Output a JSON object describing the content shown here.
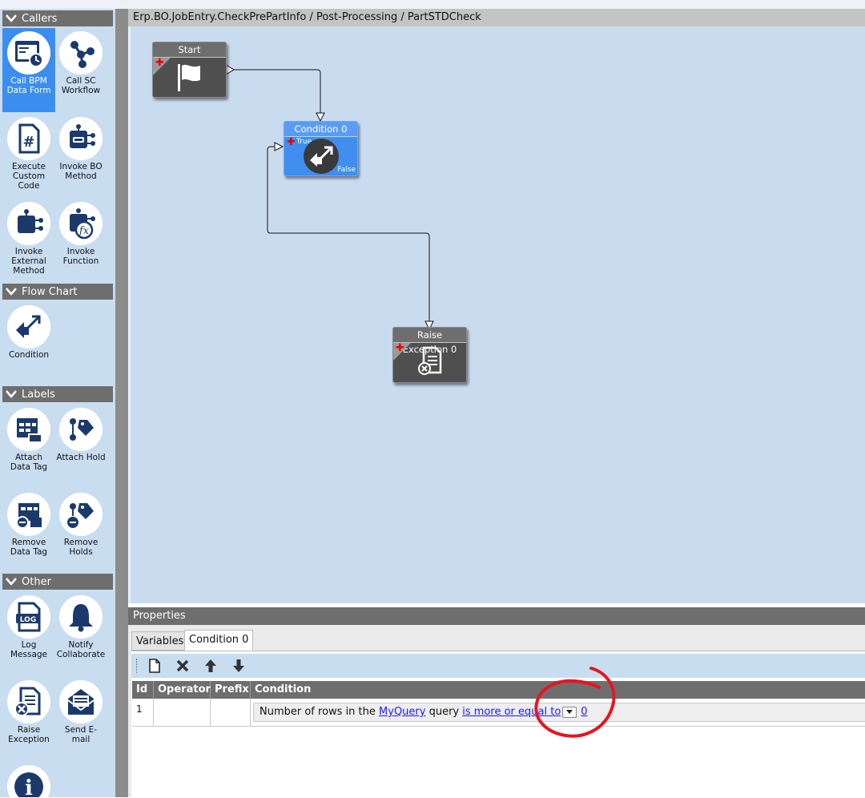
{
  "toolbox": {
    "sections": {
      "callers": "Callers",
      "flowchart": "Flow Chart",
      "labels": "Labels",
      "other": "Other"
    },
    "tools": {
      "call_bpm_data_form": "Call BPM Data Form",
      "call_sc_workflow": "Call SC Workflow",
      "execute_custom_code": "Execute Custom Code",
      "invoke_bo_method": "Invoke BO Method",
      "invoke_external_method": "Invoke External Method",
      "invoke_function": "Invoke Function",
      "condition": "Condition",
      "attach_data_tag": "Attach Data Tag",
      "attach_hold": "Attach Hold",
      "remove_data_tag": "Remove Data Tag",
      "remove_holds": "Remove Holds",
      "log_message": "Log Message",
      "notify_collaborate": "Notify Collaborate",
      "raise_exception": "Raise Exception",
      "send_email": "Send E-mail"
    }
  },
  "canvas": {
    "breadcrumb": "Erp.BO.JobEntry.CheckPrePartInfo / Post-Processing / PartSTDCheck",
    "nodes": {
      "start": {
        "title": "Start"
      },
      "condition": {
        "title": "Condition 0",
        "true_label": "True",
        "false_label": "False"
      },
      "raise_exception": {
        "title": "Raise Exception 0"
      }
    }
  },
  "properties": {
    "title": "Properties",
    "tabs": {
      "variables": "Variables",
      "condition": "Condition 0"
    },
    "grid": {
      "columns": {
        "id": "Id",
        "operator": "Operator",
        "prefix": "Prefix",
        "condition": "Condition"
      },
      "rows": [
        {
          "id": "1",
          "operator": "",
          "prefix": "",
          "condition": {
            "text_before": "Number of rows in the",
            "query_link": "MyQuery",
            "text_mid": "query",
            "operator_link": "is more or equal to",
            "value_link": "0"
          }
        }
      ]
    }
  },
  "annotation": {
    "color": "#e8141e",
    "shape": "hand-drawn-circle"
  },
  "colors": {
    "accent_selected": "#3b8ef0",
    "toolbox_bg": "#c9ddf1",
    "canvas_bg": "#c9dbef",
    "header_gray": "#6e6e6e",
    "icon_navy": "#1b3a6b"
  }
}
